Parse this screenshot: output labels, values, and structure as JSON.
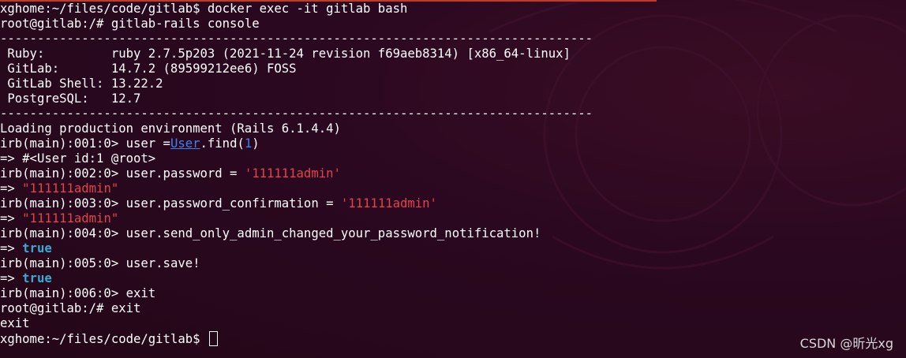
{
  "prompt_host": "xghome:~/files/code/gitlab$",
  "root_prompt": "root@gitlab:/#",
  "cmd_docker": "docker exec -it gitlab bash",
  "cmd_console": "gitlab-rails console",
  "separator": "--------------------------------------------------------------------------------",
  "info": [
    {
      "label": " Ruby:         ",
      "value": "ruby 2.7.5p203 (2021-11-24 revision f69aeb8314) [x86_64-linux]"
    },
    {
      "label": " GitLab:       ",
      "value": "14.7.2 (89599212ee6) FOSS"
    },
    {
      "label": " GitLab Shell: ",
      "value": "13.22.2"
    },
    {
      "label": " PostgreSQL:   ",
      "value": "12.7"
    }
  ],
  "loading": "Loading production environment (Rails 6.1.4.4)",
  "irb": {
    "p1": "irb(main):001:0> ",
    "p2": "irb(main):002:0> ",
    "p3": "irb(main):003:0> ",
    "p4": "irb(main):004:0> ",
    "p5": "irb(main):005:0> ",
    "p6": "irb(main):006:0> "
  },
  "code": {
    "find_pre": "user =",
    "find_class": "User",
    "find_mid": ".find(",
    "find_arg": "1",
    "find_post": ")",
    "password_pre": "user.password = ",
    "confirm_pre": "user.password_confirmation = ",
    "password_str": "'111111admin'",
    "notify": "user.send_only_admin_changed_your_password_notification!",
    "save": "user.save!",
    "exit": "exit"
  },
  "results": {
    "arrow": "=> ",
    "user_obj": "#<User id:1 @root>",
    "password_val": "\"111111admin\"",
    "true_val": "true"
  },
  "exit_output": "exit",
  "watermark": "CSDN @昕光xg",
  "colors": {
    "background": "#2c0a22",
    "string": "#e3434a",
    "keyword": "#39a9d6",
    "class": "#3b82f6"
  }
}
